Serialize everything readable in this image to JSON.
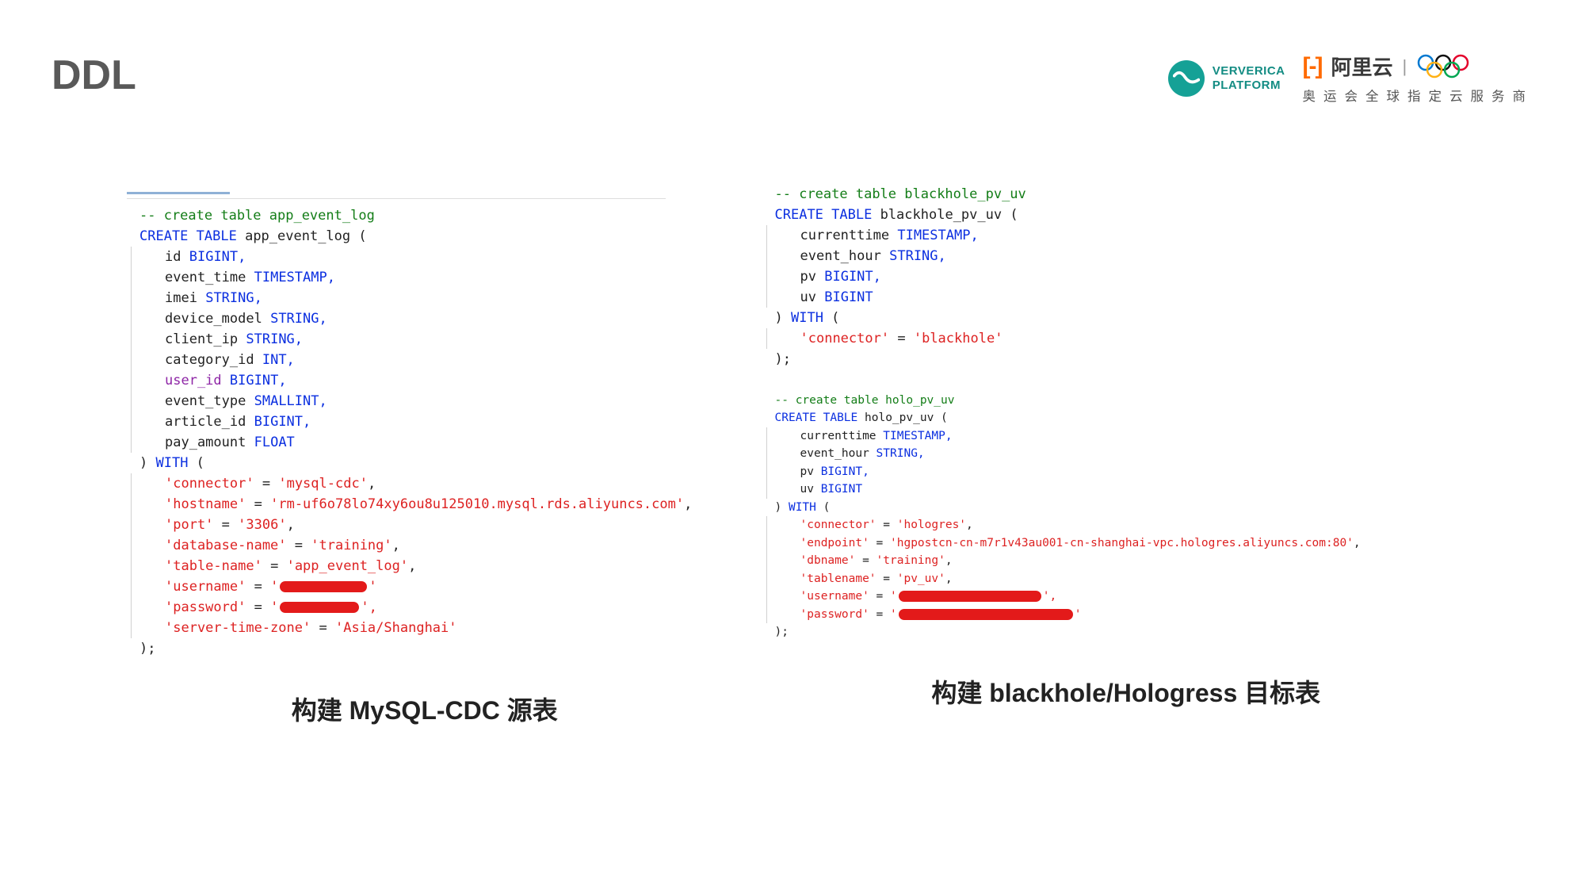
{
  "title": "DDL",
  "ververica_line1": "VERVERICA",
  "ververica_line2": "PLATFORM",
  "aliyun_name": "阿里云",
  "aliyun_tagline": "奥运会全球指定云服务商",
  "left": {
    "caption": "构建 MySQL-CDC 源表",
    "code": {
      "comment": "-- create table app_event_log",
      "create": "CREATE TABLE",
      "table_name": "app_event_log (",
      "cols": [
        {
          "name": "id",
          "type": "BIGINT,"
        },
        {
          "name": "event_time",
          "type": "TIMESTAMP,"
        },
        {
          "name": "imei",
          "type": "STRING,"
        },
        {
          "name": "device_model",
          "type": "STRING,"
        },
        {
          "name": "client_ip",
          "type": "STRING,"
        },
        {
          "name": "category_id",
          "type": "INT,"
        },
        {
          "name": "user_id",
          "type": "BIGINT,",
          "purple": true
        },
        {
          "name": "event_type",
          "type": "SMALLINT,"
        },
        {
          "name": "article_id",
          "type": "BIGINT,"
        },
        {
          "name": "pay_amount",
          "type": "FLOAT"
        }
      ],
      "with": ") WITH (",
      "opts": [
        {
          "k": "'connector'",
          "v": "'mysql-cdc'",
          "comma": ","
        },
        {
          "k": "'hostname'",
          "v": "'rm-uf6o78lo74xy6ou8u125010.mysql.rds.aliyuncs.com'",
          "comma": ","
        },
        {
          "k": "'port'",
          "v": "'3306'",
          "comma": ","
        },
        {
          "k": "'database-name'",
          "v": "'training'",
          "comma": ","
        },
        {
          "k": "'table-name'",
          "v": "'app_event_log'",
          "comma": ","
        },
        {
          "k": "'username'",
          "v": "'",
          "redact": 110,
          "tail": "'",
          "comma": ""
        },
        {
          "k": "'password'",
          "v": "'",
          "redact": 100,
          "tail": "',",
          "comma": ""
        },
        {
          "k": "'server-time-zone'",
          "v": "'Asia/Shanghai'",
          "comma": ""
        }
      ],
      "end": ");"
    }
  },
  "right": {
    "caption": "构建 blackhole/Hologress 目标表",
    "code1": {
      "comment": "-- create table blackhole_pv_uv",
      "create": "CREATE TABLE",
      "table_name": "blackhole_pv_uv (",
      "cols": [
        {
          "name": "currenttime",
          "type": "TIMESTAMP,"
        },
        {
          "name": "event_hour",
          "type": "STRING,"
        },
        {
          "name": "pv",
          "type": "BIGINT,"
        },
        {
          "name": "uv",
          "type": "BIGINT"
        }
      ],
      "with": ") WITH (",
      "opts": [
        {
          "k": "'connector'",
          "v": "'blackhole'",
          "comma": ""
        }
      ],
      "end": ");"
    },
    "code2": {
      "comment": "-- create table holo_pv_uv",
      "create": "CREATE TABLE",
      "table_name": "holo_pv_uv (",
      "cols": [
        {
          "name": "currenttime",
          "type": "TIMESTAMP,"
        },
        {
          "name": "event_hour",
          "type": "STRING,"
        },
        {
          "name": "pv",
          "type": "BIGINT,"
        },
        {
          "name": "uv",
          "type": "BIGINT"
        }
      ],
      "with": ") WITH (",
      "opts": [
        {
          "k": "'connector'",
          "v": "'hologres'",
          "comma": ","
        },
        {
          "k": "'endpoint'",
          "v": "'hgpostcn-cn-m7r1v43au001-cn-shanghai-vpc.hologres.aliyuncs.com:80'",
          "comma": ","
        },
        {
          "k": "'dbname'",
          "v": "'training'",
          "comma": ","
        },
        {
          "k": "'tablename'",
          "v": "'pv_uv'",
          "comma": ","
        },
        {
          "k": "'username'",
          "v": "'",
          "redact": 180,
          "tail": "',",
          "comma": ""
        },
        {
          "k": "'password'",
          "v": "'",
          "redact": 220,
          "tail": "'",
          "comma": ""
        }
      ],
      "end": ");"
    }
  }
}
